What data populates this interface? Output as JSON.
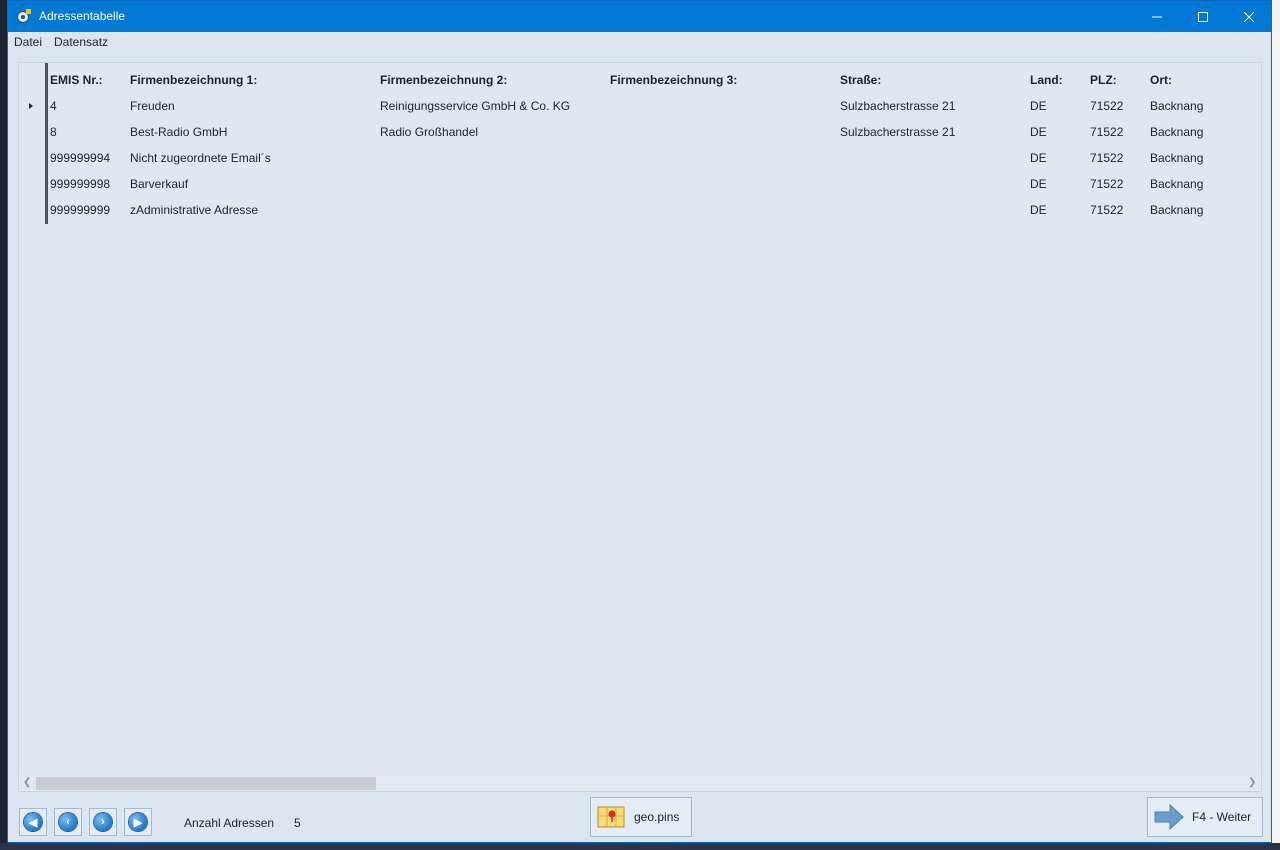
{
  "window": {
    "title": "Adressentabelle",
    "minimize_glyph": "—",
    "maximize_glyph": "☐",
    "close_glyph": "✕"
  },
  "menu": [
    "Datei",
    "Datensatz"
  ],
  "table": {
    "columns": [
      "EMIS Nr.:",
      "Firmenbezeichnung 1:",
      "Firmenbezeichnung 2:",
      "Firmenbezeichnung 3:",
      "Straße:",
      "Land:",
      "PLZ:",
      "Ort:"
    ],
    "rows": [
      [
        "4",
        "Freuden",
        "Reinigungsservice GmbH & Co. KG",
        "",
        "Sulzbacherstrasse 21",
        "DE",
        "71522",
        "Backnang"
      ],
      [
        "8",
        "Best-Radio GmbH",
        "Radio Großhandel",
        "",
        "Sulzbacherstrasse 21",
        "DE",
        "71522",
        "Backnang"
      ],
      [
        "999999994",
        "Nicht zugeordnete Email´s",
        "",
        "",
        "",
        "DE",
        "71522",
        "Backnang"
      ],
      [
        "999999998",
        "Barverkauf",
        "",
        "",
        "",
        "DE",
        "71522",
        "Backnang"
      ],
      [
        "999999999",
        "zAdministrative Adresse",
        "",
        "",
        "",
        "DE",
        "71522",
        "Backnang"
      ]
    ],
    "selected_row": 0
  },
  "footer": {
    "count_label": "Anzahl Adressen",
    "count_value": "5",
    "geo_label": "geo.pins",
    "next_label": "F4 - Weiter"
  },
  "icons": {
    "nav": [
      "first-record-icon",
      "previous-record-icon",
      "next-record-icon",
      "last-record-icon"
    ],
    "geo": "map-pin-icon",
    "next": "arrow-right-icon"
  }
}
